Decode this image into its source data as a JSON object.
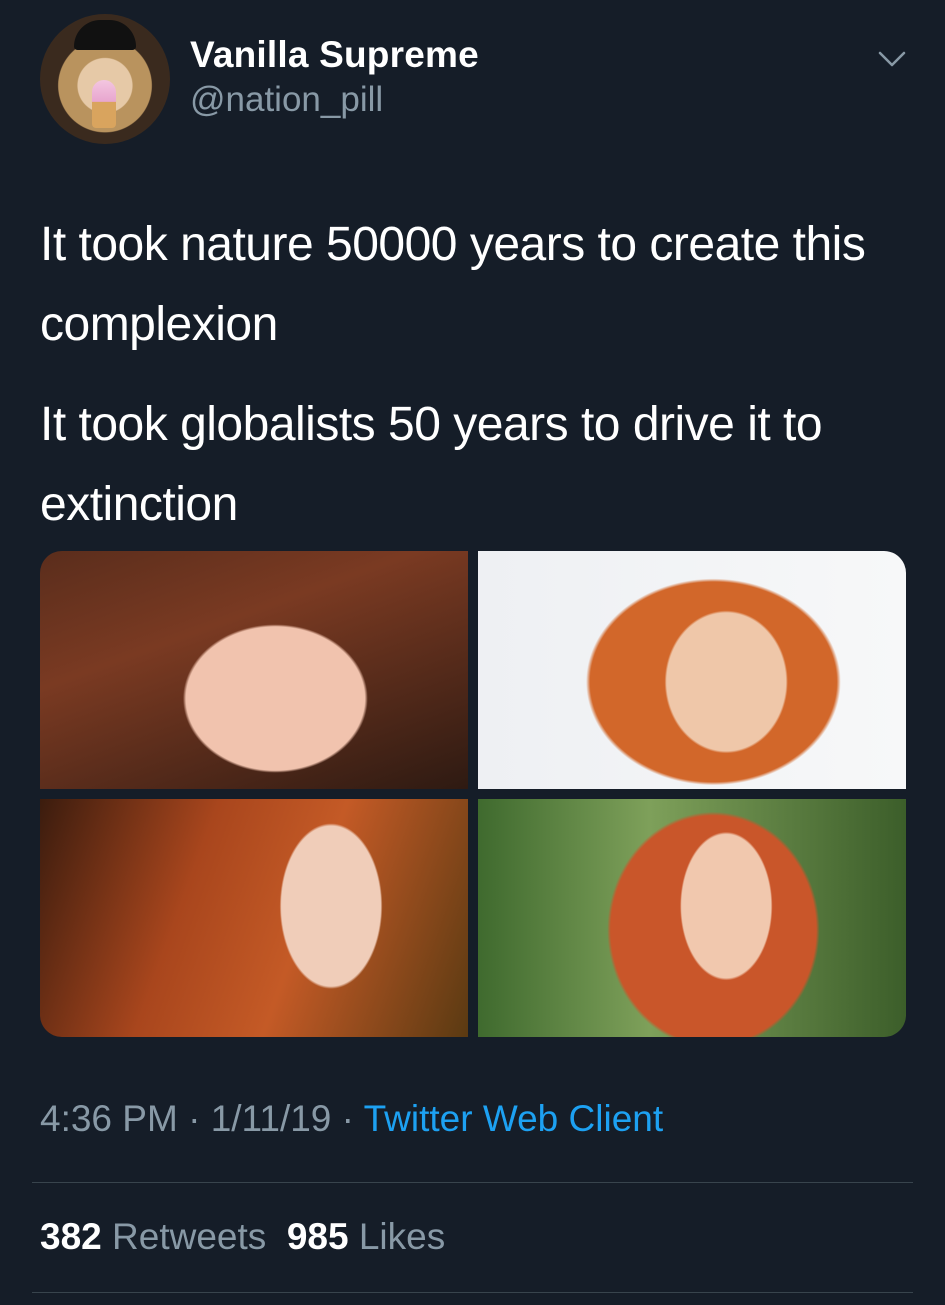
{
  "tweet": {
    "author": {
      "name": "Vanilla Supreme",
      "handle": "@nation_pill"
    },
    "text_lines": [
      "It took nature 50000 years to create this complexion",
      "It took globalists 50 years to drive it to extinction"
    ],
    "media": [
      {
        "alt": "photo-1"
      },
      {
        "alt": "photo-2"
      },
      {
        "alt": "photo-3"
      },
      {
        "alt": "photo-4"
      }
    ],
    "time": "4:36 PM",
    "date": "1/11/19",
    "separator": " · ",
    "client": "Twitter Web Client",
    "stats": {
      "retweets_count": "382",
      "retweets_label": "Retweets",
      "likes_count": "985",
      "likes_label": "Likes"
    }
  },
  "colors": {
    "background": "#151d28",
    "secondary_text": "#8899a6",
    "link": "#1da1f2",
    "divider": "#38444d"
  },
  "icons": {
    "menu": "chevron-down-icon"
  }
}
